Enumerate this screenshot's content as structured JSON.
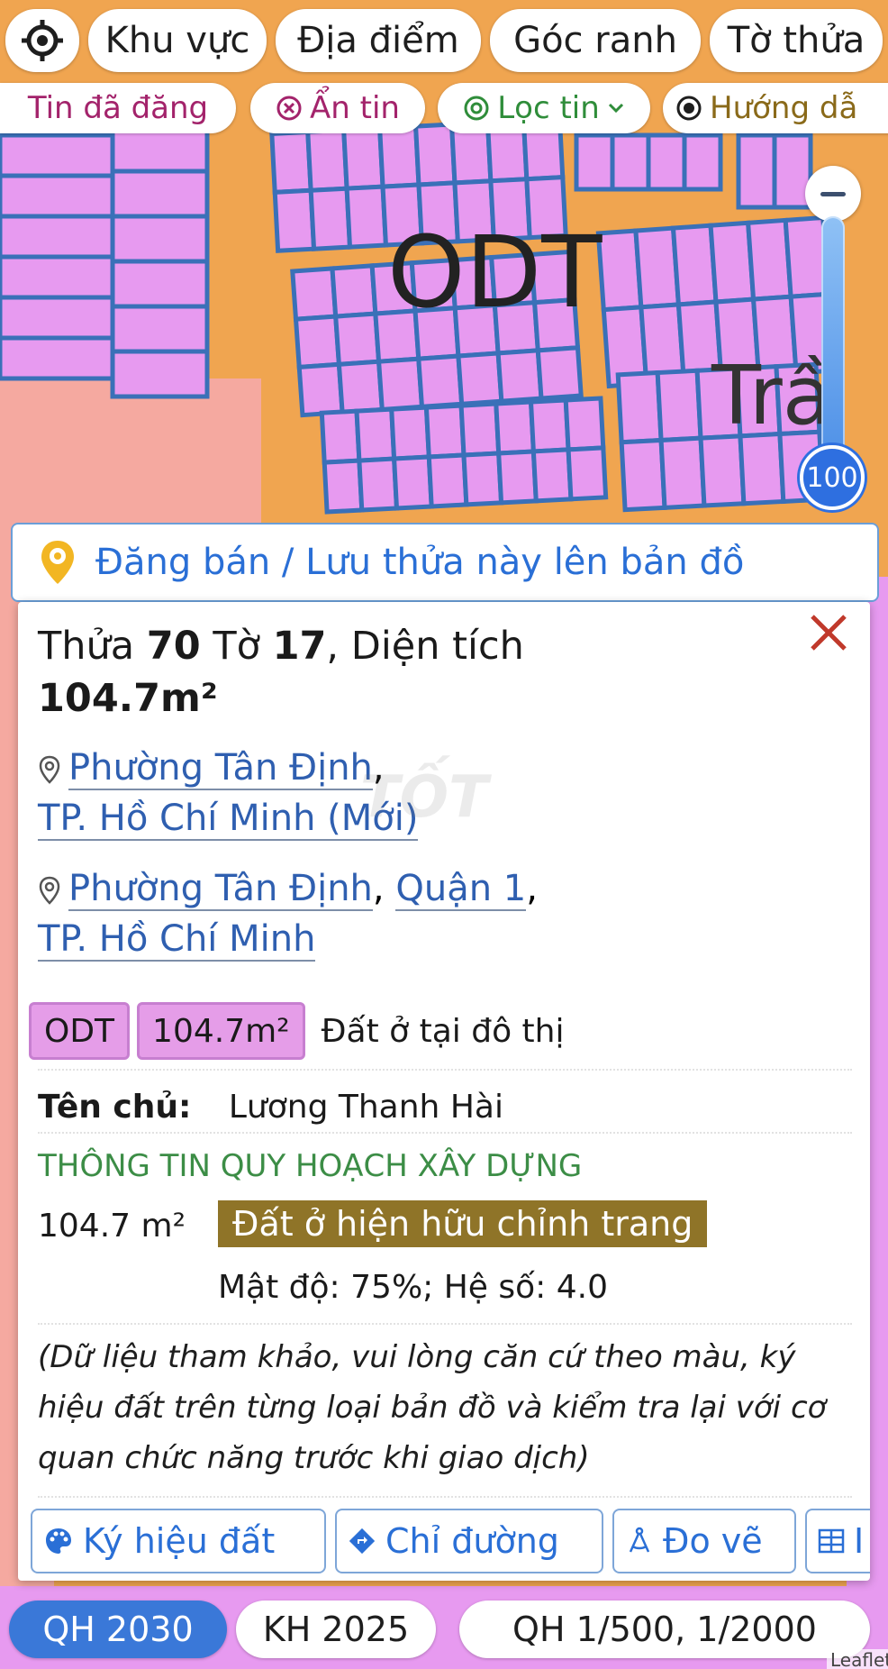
{
  "colors": {
    "map_road": "#f0a550",
    "map_plot": "#e79af0",
    "map_plot_border": "#3a70b8",
    "accent_blue": "#2a6fd6",
    "tag_pink": "#e59de8",
    "planning_gold": "#8f7428",
    "planning_green": "#3c8d46",
    "active_chip": "#3a78d8"
  },
  "map": {
    "label_odt": "ODT",
    "label_partial": "Trầ"
  },
  "toolbar_row1": {
    "locate_icon": "crosshair-icon",
    "khu_vuc": "Khu vực",
    "dia_diem": "Địa điểm",
    "goc_ranh": "Góc ranh",
    "to_thua": "Tờ thửa"
  },
  "toolbar_row2": {
    "tin_da_dang": "Tin đã đăng",
    "an_tin": "Ẩn tin",
    "loc_tin": "Lọc tin",
    "huong_dan": "Hướng dẫ"
  },
  "zoom": {
    "level": "100"
  },
  "banner": {
    "text": "Đăng bán / Lưu thửa này lên bản đồ"
  },
  "parcel": {
    "thua_label": "Thửa",
    "thua_number": "70",
    "to_label": "Tờ",
    "to_number": "17",
    "dien_tich_label": ", Diện tích",
    "area": "104.7m²",
    "new_ward": "Phường Tân Định",
    "new_city": "TP. Hồ Chí Minh (Mới)",
    "old_ward": "Phường Tân Định",
    "old_district": "Quận 1",
    "old_city": "TP. Hồ Chí Minh",
    "comma": ","
  },
  "land": {
    "code": "ODT",
    "area": "104.7m²",
    "description": "Đất ở tại đô thị"
  },
  "owner": {
    "label": "Tên chủ:",
    "name": "Lương Thanh Hài"
  },
  "planning": {
    "heading": "THÔNG TIN QUY HOẠCH XÂY DỰNG",
    "area": "104.7 m²",
    "type": "Đất ở hiện hữu chỉnh trang",
    "density": "Mật độ: 75%; Hệ số: 4.0"
  },
  "disclaimer": {
    "line1": "(Dữ liệu tham khảo, vui lòng căn cứ theo màu, ký",
    "line2": "hiệu đất trên từng loại bản đồ và kiểm tra lại với cơ",
    "line3": "quan chức năng trước khi giao dịch)"
  },
  "panel_buttons": {
    "ky_hieu_dat": "Ký hiệu đất",
    "chi_duong": "Chỉ đường",
    "do_ve": "Đo vẽ",
    "more": "I"
  },
  "bottom_tabs": {
    "qh2030": "QH 2030",
    "kh2025": "KH 2025",
    "qh500": "QH 1/500, 1/2000"
  },
  "watermark": "TỐT",
  "attribution": "Leaflet"
}
